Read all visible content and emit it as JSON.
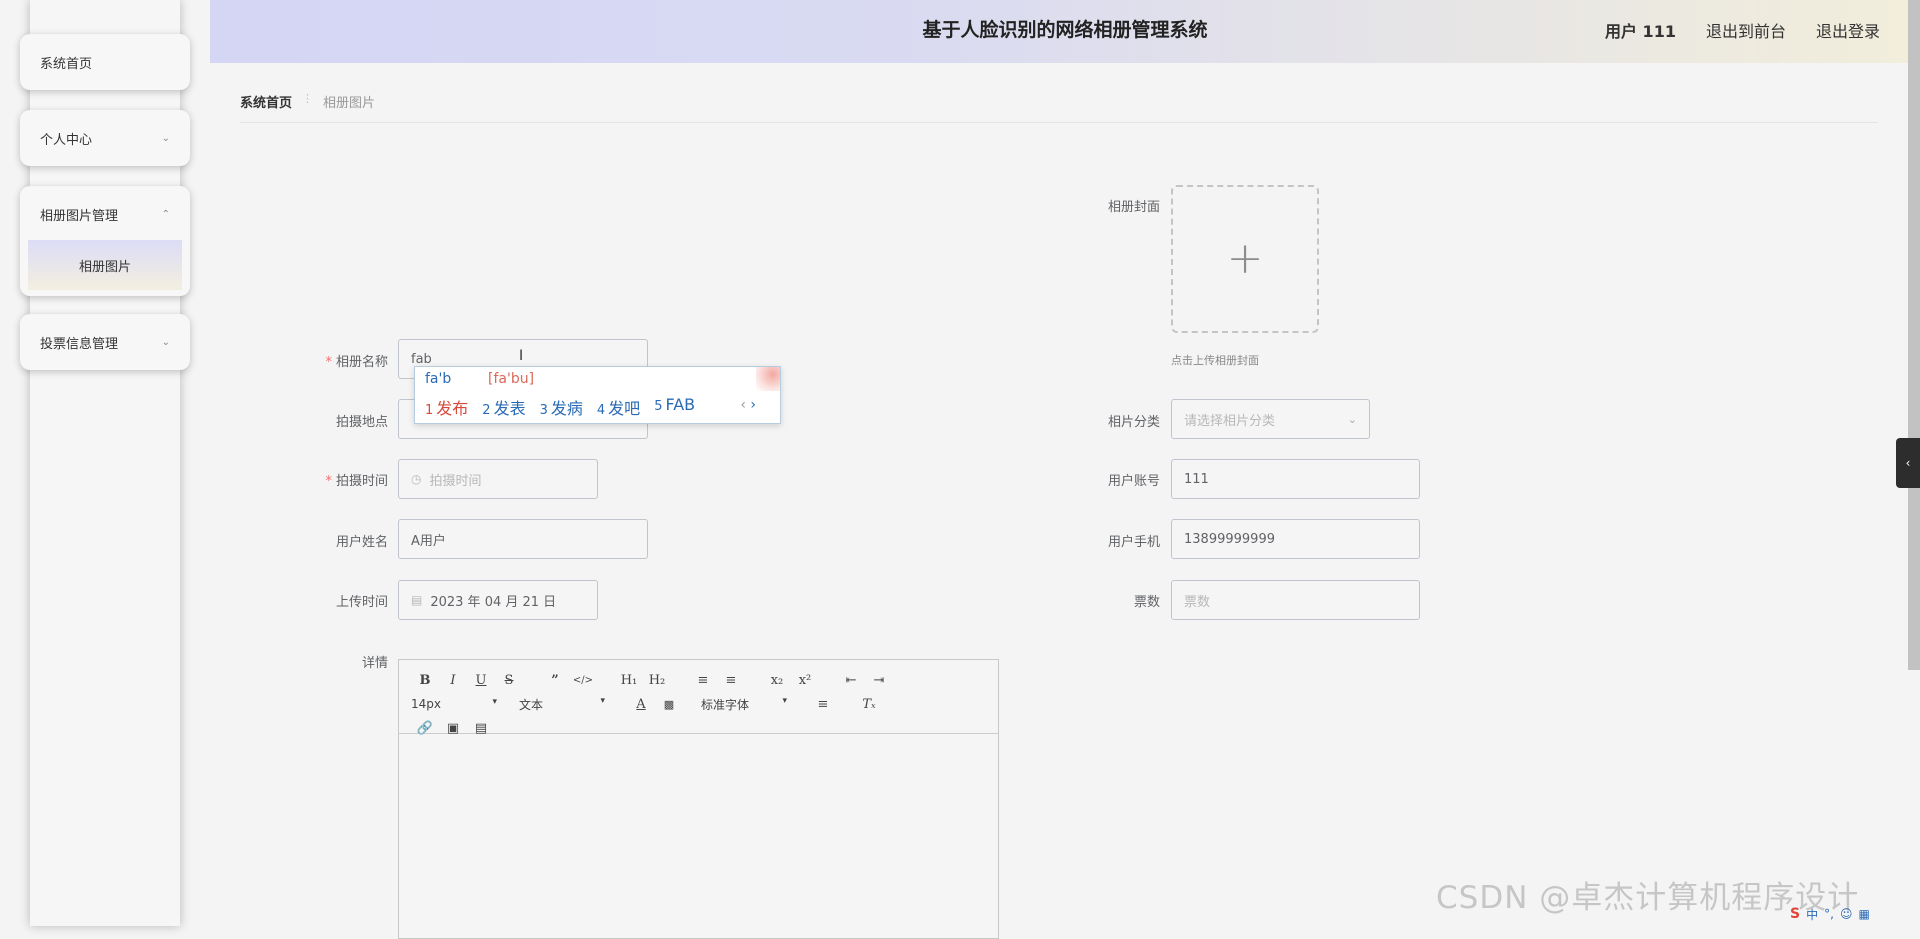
{
  "sidebar": {
    "items": [
      {
        "label": "系统首页"
      },
      {
        "label": "个人中心"
      },
      {
        "label": "相册图片管理",
        "children": [
          {
            "label": "相册图片"
          }
        ]
      },
      {
        "label": "投票信息管理"
      }
    ]
  },
  "header": {
    "title": "基于人脸识别的网络相册管理系统",
    "user": "用户 111",
    "to_front": "退出到前台",
    "logout": "退出登录"
  },
  "breadcrumb": {
    "home": "系统首页",
    "current": "相册图片"
  },
  "form": {
    "cover": {
      "label": "相册封面",
      "tip": "点击上传相册封面"
    },
    "album_name": {
      "label": "相册名称",
      "value": "fab"
    },
    "location": {
      "label": "拍摄地点"
    },
    "shoot_time": {
      "label": "拍摄时间",
      "placeholder": "拍摄时间"
    },
    "user_name": {
      "label": "用户姓名",
      "value": "A用户"
    },
    "upload_time": {
      "label": "上传时间",
      "value": "2023 年 04 月 21 日"
    },
    "category": {
      "label": "相片分类",
      "placeholder": "请选择相片分类"
    },
    "account": {
      "label": "用户账号",
      "value": "111"
    },
    "phone": {
      "label": "用户手机",
      "value": "13899999999"
    },
    "votes": {
      "label": "票数",
      "placeholder": "票数"
    },
    "details": {
      "label": "详情"
    }
  },
  "editor": {
    "font_size": "14px",
    "block_type": "文本",
    "font_family": "标准字体"
  },
  "ime": {
    "pinyin": "fa'b",
    "full": "[fa'bu]",
    "candidates": [
      {
        "n": "1",
        "text": "发布"
      },
      {
        "n": "2",
        "text": "发表"
      },
      {
        "n": "3",
        "text": "发病"
      },
      {
        "n": "4",
        "text": "发吧"
      },
      {
        "n": "5",
        "text": "FAB"
      }
    ]
  },
  "watermark": "CSDN @卓杰计算机程序设计",
  "tray": {
    "ime_mode": "中"
  }
}
